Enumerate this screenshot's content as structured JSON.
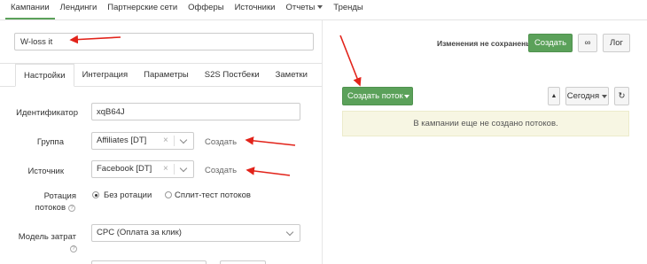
{
  "nav": {
    "items": [
      "Кампании",
      "Лендинги",
      "Партнерские сети",
      "Офферы",
      "Источники",
      "Отчеты",
      "Тренды"
    ]
  },
  "campaign": {
    "name": "W-loss it",
    "unsaved_text": "Изменения не сохранены",
    "save_label": "Создать",
    "link_icon": "∞",
    "log_label": "Лог"
  },
  "tabs": [
    "Настройки",
    "Интеграция",
    "Параметры",
    "S2S Постбеки",
    "Заметки"
  ],
  "form": {
    "id_label": "Идентификатор",
    "id_value": "xqB64J",
    "group_label": "Группа",
    "group_value": "Affiliates [DT]",
    "group_create": "Создать",
    "source_label": "Источник",
    "source_value": "Facebook [DT]",
    "source_create": "Создать",
    "rotation_label_1": "Ротация",
    "rotation_label_2": "потоков",
    "rotation_opt1": "Без ротации",
    "rotation_opt2": "Сплит-тест потоков",
    "cost_label_1": "Модель затрат",
    "cost_value": "CPC (Оплата за клик)",
    "clear_icon": "×",
    "help_icon": "?"
  },
  "streams": {
    "create_label": "Создать поток",
    "period_label": "Сегодня",
    "empty_text": "В кампании еще не создано потоков.",
    "up_icon": "▲",
    "refresh_icon": "↻"
  },
  "colors": {
    "accent": "#5ba15a",
    "annotation": "#e2231a",
    "notice_bg": "#f7f6e3"
  }
}
